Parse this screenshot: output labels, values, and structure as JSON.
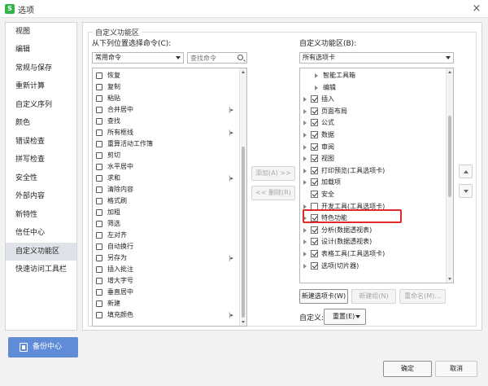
{
  "window": {
    "title": "选项",
    "app_icon_letter": "S",
    "close_glyph": "×"
  },
  "sidebar": {
    "items": [
      {
        "label": "视图"
      },
      {
        "label": "编辑"
      },
      {
        "label": "常规与保存"
      },
      {
        "label": "重新计算"
      },
      {
        "label": "自定义序列"
      },
      {
        "label": "颜色"
      },
      {
        "label": "错误检查"
      },
      {
        "label": "拼写检查"
      },
      {
        "label": "安全性"
      },
      {
        "label": "外部内容"
      },
      {
        "label": "新特性"
      },
      {
        "label": "信任中心"
      },
      {
        "label": "自定义功能区",
        "active": true
      },
      {
        "label": "快速访问工具栏"
      }
    ],
    "backup_label": "备份中心"
  },
  "main": {
    "section_title": "自定义功能区",
    "left_label": "从下列位置选择命令(C):",
    "left_select": "常用命令",
    "search_placeholder": "查找命令",
    "commands": [
      {
        "label": "恢复",
        "icon": "redo-icon"
      },
      {
        "label": "复制",
        "icon": "copy-icon"
      },
      {
        "label": "粘贴",
        "icon": "paste-icon"
      },
      {
        "label": "合并居中",
        "icon": "merge-center-icon",
        "submenu": true
      },
      {
        "label": "查找",
        "icon": "find-icon"
      },
      {
        "label": "所有框线",
        "icon": "borders-icon",
        "submenu": true
      },
      {
        "label": "重算活动工作簿",
        "icon": "recalc-icon"
      },
      {
        "label": "剪切",
        "icon": "cut-icon"
      },
      {
        "label": "水平居中",
        "icon": "align-center-icon"
      },
      {
        "label": "求和",
        "icon": "sum-icon",
        "submenu": true
      },
      {
        "label": "清除内容",
        "icon": "clear-icon"
      },
      {
        "label": "格式刷",
        "icon": "format-painter-icon"
      },
      {
        "label": "加粗",
        "icon": "bold-icon"
      },
      {
        "label": "筛选",
        "icon": "filter-icon"
      },
      {
        "label": "左对齐",
        "icon": "align-left-icon"
      },
      {
        "label": "自动换行",
        "icon": "wrap-text-icon"
      },
      {
        "label": "另存为",
        "icon": "save-as-icon",
        "submenu": true
      },
      {
        "label": "插入批注",
        "icon": "comment-icon"
      },
      {
        "label": "增大字号",
        "icon": "font-grow-icon"
      },
      {
        "label": "垂直居中",
        "icon": "align-middle-icon"
      },
      {
        "label": "新建",
        "icon": "new-icon"
      },
      {
        "label": "填充颜色",
        "icon": "fill-color-icon",
        "submenu": true
      }
    ],
    "add_button": "添加(A) >>",
    "remove_button": "<< 删除(R)",
    "right_label": "自定义功能区(B):",
    "right_select": "所有选项卡",
    "tabs": [
      {
        "label": "智能工具箱",
        "level": 2,
        "checkbox": false
      },
      {
        "label": "编辑",
        "level": 2,
        "checkbox": false
      },
      {
        "label": "插入",
        "level": 1,
        "checked": true
      },
      {
        "label": "页面布局",
        "level": 1,
        "checked": true
      },
      {
        "label": "公式",
        "level": 1,
        "checked": true
      },
      {
        "label": "数据",
        "level": 1,
        "checked": true
      },
      {
        "label": "审阅",
        "level": 1,
        "checked": true
      },
      {
        "label": "视图",
        "level": 1,
        "checked": true
      },
      {
        "label": "打印预览(工具选项卡)",
        "level": 1,
        "checked": true
      },
      {
        "label": "加载项",
        "level": 1,
        "checked": true
      },
      {
        "label": "安全",
        "level": 1,
        "checked": true,
        "no_expander": true
      },
      {
        "label": "开发工具(工具选项卡)",
        "level": 1,
        "checked": false,
        "highlighted": true
      },
      {
        "label": "特色功能",
        "level": 1,
        "checked": true
      },
      {
        "label": "分析(数据透视表)",
        "level": 1,
        "checked": true
      },
      {
        "label": "设计(数据透视表)",
        "level": 1,
        "checked": true
      },
      {
        "label": "表格工具(工具选项卡)",
        "level": 1,
        "checked": true
      },
      {
        "label": "选项(切片器)",
        "level": 1,
        "checked": true
      }
    ],
    "new_tab_button": "新建选项卡(W)",
    "new_group_button": "新建组(N)",
    "rename_button": "重命名(M)...",
    "customize_label": "自定义:",
    "reset_button": "重置(E)"
  },
  "footer": {
    "ok_button": "确定",
    "cancel_button": "取消"
  },
  "colors": {
    "accent": "#5f8bd7",
    "highlight_border": "#e02a2a",
    "app_icon": "#2fb54a"
  }
}
